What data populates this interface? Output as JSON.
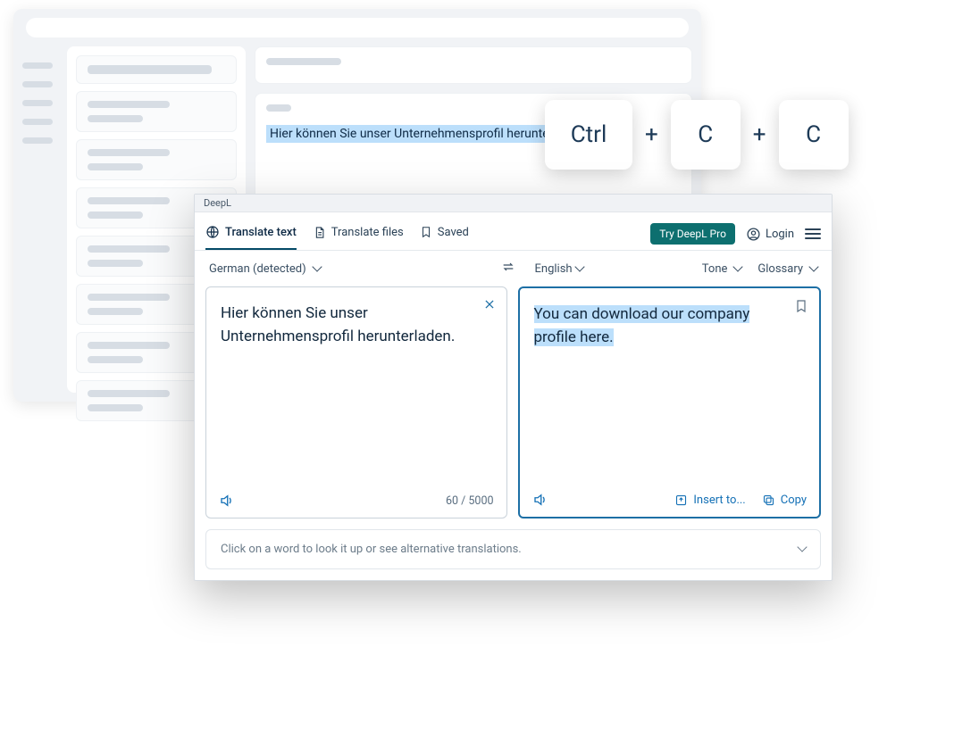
{
  "background": {
    "highlighted_text": "Hier können Sie unser Unternehmensprofil herunterladen"
  },
  "shortcut": {
    "key1": "Ctrl",
    "sep1": "+",
    "key2": "C",
    "sep2": "+",
    "key3": "C"
  },
  "deepl": {
    "title": "DeepL",
    "tabs": {
      "translate_text": "Translate text",
      "translate_files": "Translate files",
      "saved": "Saved"
    },
    "header": {
      "pro_button": "Try DeepL Pro",
      "login": "Login"
    },
    "langbar": {
      "source": "German (detected)",
      "target": "English",
      "tone": "Tone",
      "glossary": "Glossary"
    },
    "source": {
      "text": "Hier können Sie unser Unternehmensprofil herunterladen.",
      "count": "60 / 5000"
    },
    "target": {
      "text": "You can download our company profile here.",
      "insert_label": "Insert to...",
      "copy_label": "Copy"
    },
    "hint": "Click on a word to look it up or see alternative translations."
  }
}
